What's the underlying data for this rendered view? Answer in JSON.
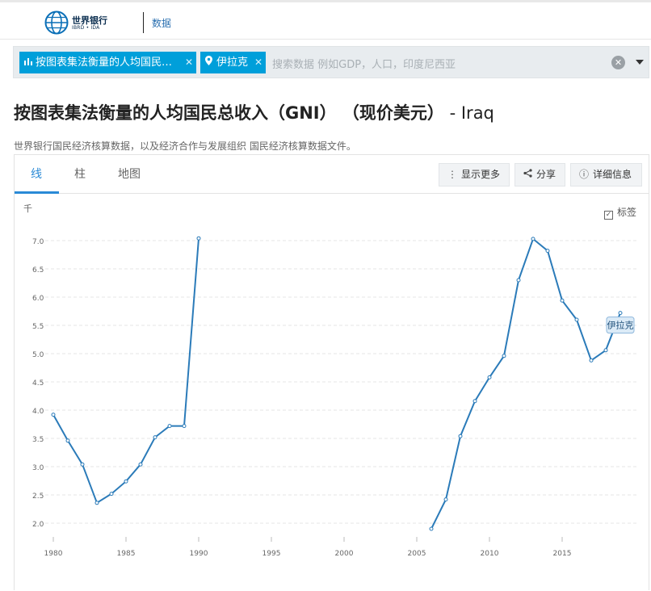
{
  "header": {
    "logo_name": "世界银行",
    "logo_sub": "IBRD • IDA",
    "nav_label": "数据"
  },
  "search": {
    "chip_indicator": "按图表集法衡量的人均国民…",
    "chip_country": "伊拉克",
    "placeholder": "搜索数据 例如GDP，人口，印度尼西亚",
    "clear_icon": "close-circle-icon",
    "dropdown_icon": "caret-down-icon"
  },
  "page": {
    "title": "按图表集法衡量的人均国民总收入（GNI） （现价美元）",
    "country_suffix": " - Iraq",
    "source": "世界银行国民经济核算数据，以及经济合作与发展组织 国民经济核算数据文件。"
  },
  "tabs": [
    {
      "label": "线",
      "active": true
    },
    {
      "label": "柱",
      "active": false
    },
    {
      "label": "地图",
      "active": false
    }
  ],
  "toolbar": {
    "more_label": "显示更多",
    "share_label": "分享",
    "details_label": "详细信息"
  },
  "chart_toggle": {
    "labels_label": "标签",
    "labels_checked": true
  },
  "colors": {
    "accent": "#009fda",
    "line": "#2b7bb9",
    "tab_active": "#2a8ad6"
  },
  "chart_data": {
    "type": "line",
    "unit": "千",
    "xlim": [
      1980,
      2019
    ],
    "ylim": [
      1.8,
      7.2
    ],
    "x_ticks": [
      1980,
      1985,
      1990,
      1995,
      2000,
      2005,
      2010,
      2015
    ],
    "y_ticks": [
      2.0,
      2.5,
      3.0,
      3.5,
      4.0,
      4.5,
      5.0,
      5.5,
      6.0,
      6.5,
      7.0
    ],
    "y_tick_labels": [
      "2.0",
      "2.5",
      "3.0",
      "3.5",
      "4.0",
      "4.5",
      "5.0",
      "5.5",
      "6.0",
      "6.5",
      "7.0"
    ],
    "grid": true,
    "series": [
      {
        "name": "伊拉克",
        "segments": [
          [
            [
              1980,
              3.92
            ],
            [
              1981,
              3.46
            ],
            [
              1982,
              3.04
            ],
            [
              1983,
              2.36
            ],
            [
              1984,
              2.52
            ],
            [
              1985,
              2.74
            ],
            [
              1986,
              3.04
            ],
            [
              1987,
              3.52
            ],
            [
              1988,
              3.72
            ],
            [
              1989,
              3.72
            ],
            [
              1990,
              7.04
            ]
          ],
          [
            [
              2006,
              1.9
            ],
            [
              2007,
              2.42
            ],
            [
              2008,
              3.54
            ],
            [
              2009,
              4.16
            ],
            [
              2010,
              4.58
            ],
            [
              2011,
              4.96
            ],
            [
              2012,
              6.3
            ],
            [
              2013,
              7.03
            ],
            [
              2014,
              6.82
            ],
            [
              2015,
              5.94
            ],
            [
              2016,
              5.6
            ],
            [
              2017,
              4.88
            ],
            [
              2018,
              5.06
            ],
            [
              2019,
              5.72
            ]
          ]
        ]
      }
    ]
  }
}
